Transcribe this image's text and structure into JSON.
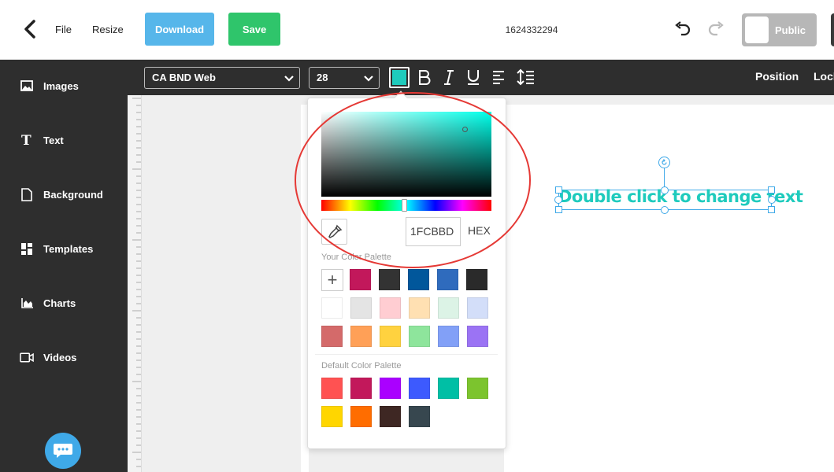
{
  "header": {
    "file_label": "File",
    "resize_label": "Resize",
    "download_label": "Download",
    "save_label": "Save",
    "document_id": "1624332294",
    "visibility_label": "Public"
  },
  "sidebar": {
    "items": [
      {
        "label": "Images",
        "icon": "image-icon"
      },
      {
        "label": "Text",
        "icon": "text-icon"
      },
      {
        "label": "Background",
        "icon": "file-icon"
      },
      {
        "label": "Templates",
        "icon": "grid-icon"
      },
      {
        "label": "Charts",
        "icon": "chart-icon"
      },
      {
        "label": "Videos",
        "icon": "video-icon"
      }
    ]
  },
  "toolbar": {
    "font_family": "CA BND Web",
    "font_size": "28",
    "text_color": "#1FCBBD",
    "position_label": "Position",
    "lock_label": "Lock"
  },
  "canvas": {
    "text_element": "Double click to change text"
  },
  "color_picker": {
    "hex_value": "1FCBBD",
    "hex_label": "HEX",
    "your_palette_title": "Your Color Palette",
    "default_palette_title": "Default Color Palette",
    "your_palette": [
      "#c2185b",
      "#333333",
      "#01579b",
      "#2f6bbd",
      "#2a2a2a",
      "#ffffff",
      "#e4e4e4",
      "#ffcdd2",
      "#ffe0b2",
      "#dcf3e6",
      "#d3def9",
      "#d46a6a",
      "#ffa057",
      "#ffd23f",
      "#8ee59c",
      "#82a0f7",
      "#9b73f4"
    ],
    "default_palette": [
      "#ff5252",
      "#c2185b",
      "#aa00ff",
      "#3d5afe",
      "#00bfa5",
      "#7cc42e",
      "#ffd600",
      "#ff6d00",
      "#3e2723",
      "#37474f"
    ]
  }
}
